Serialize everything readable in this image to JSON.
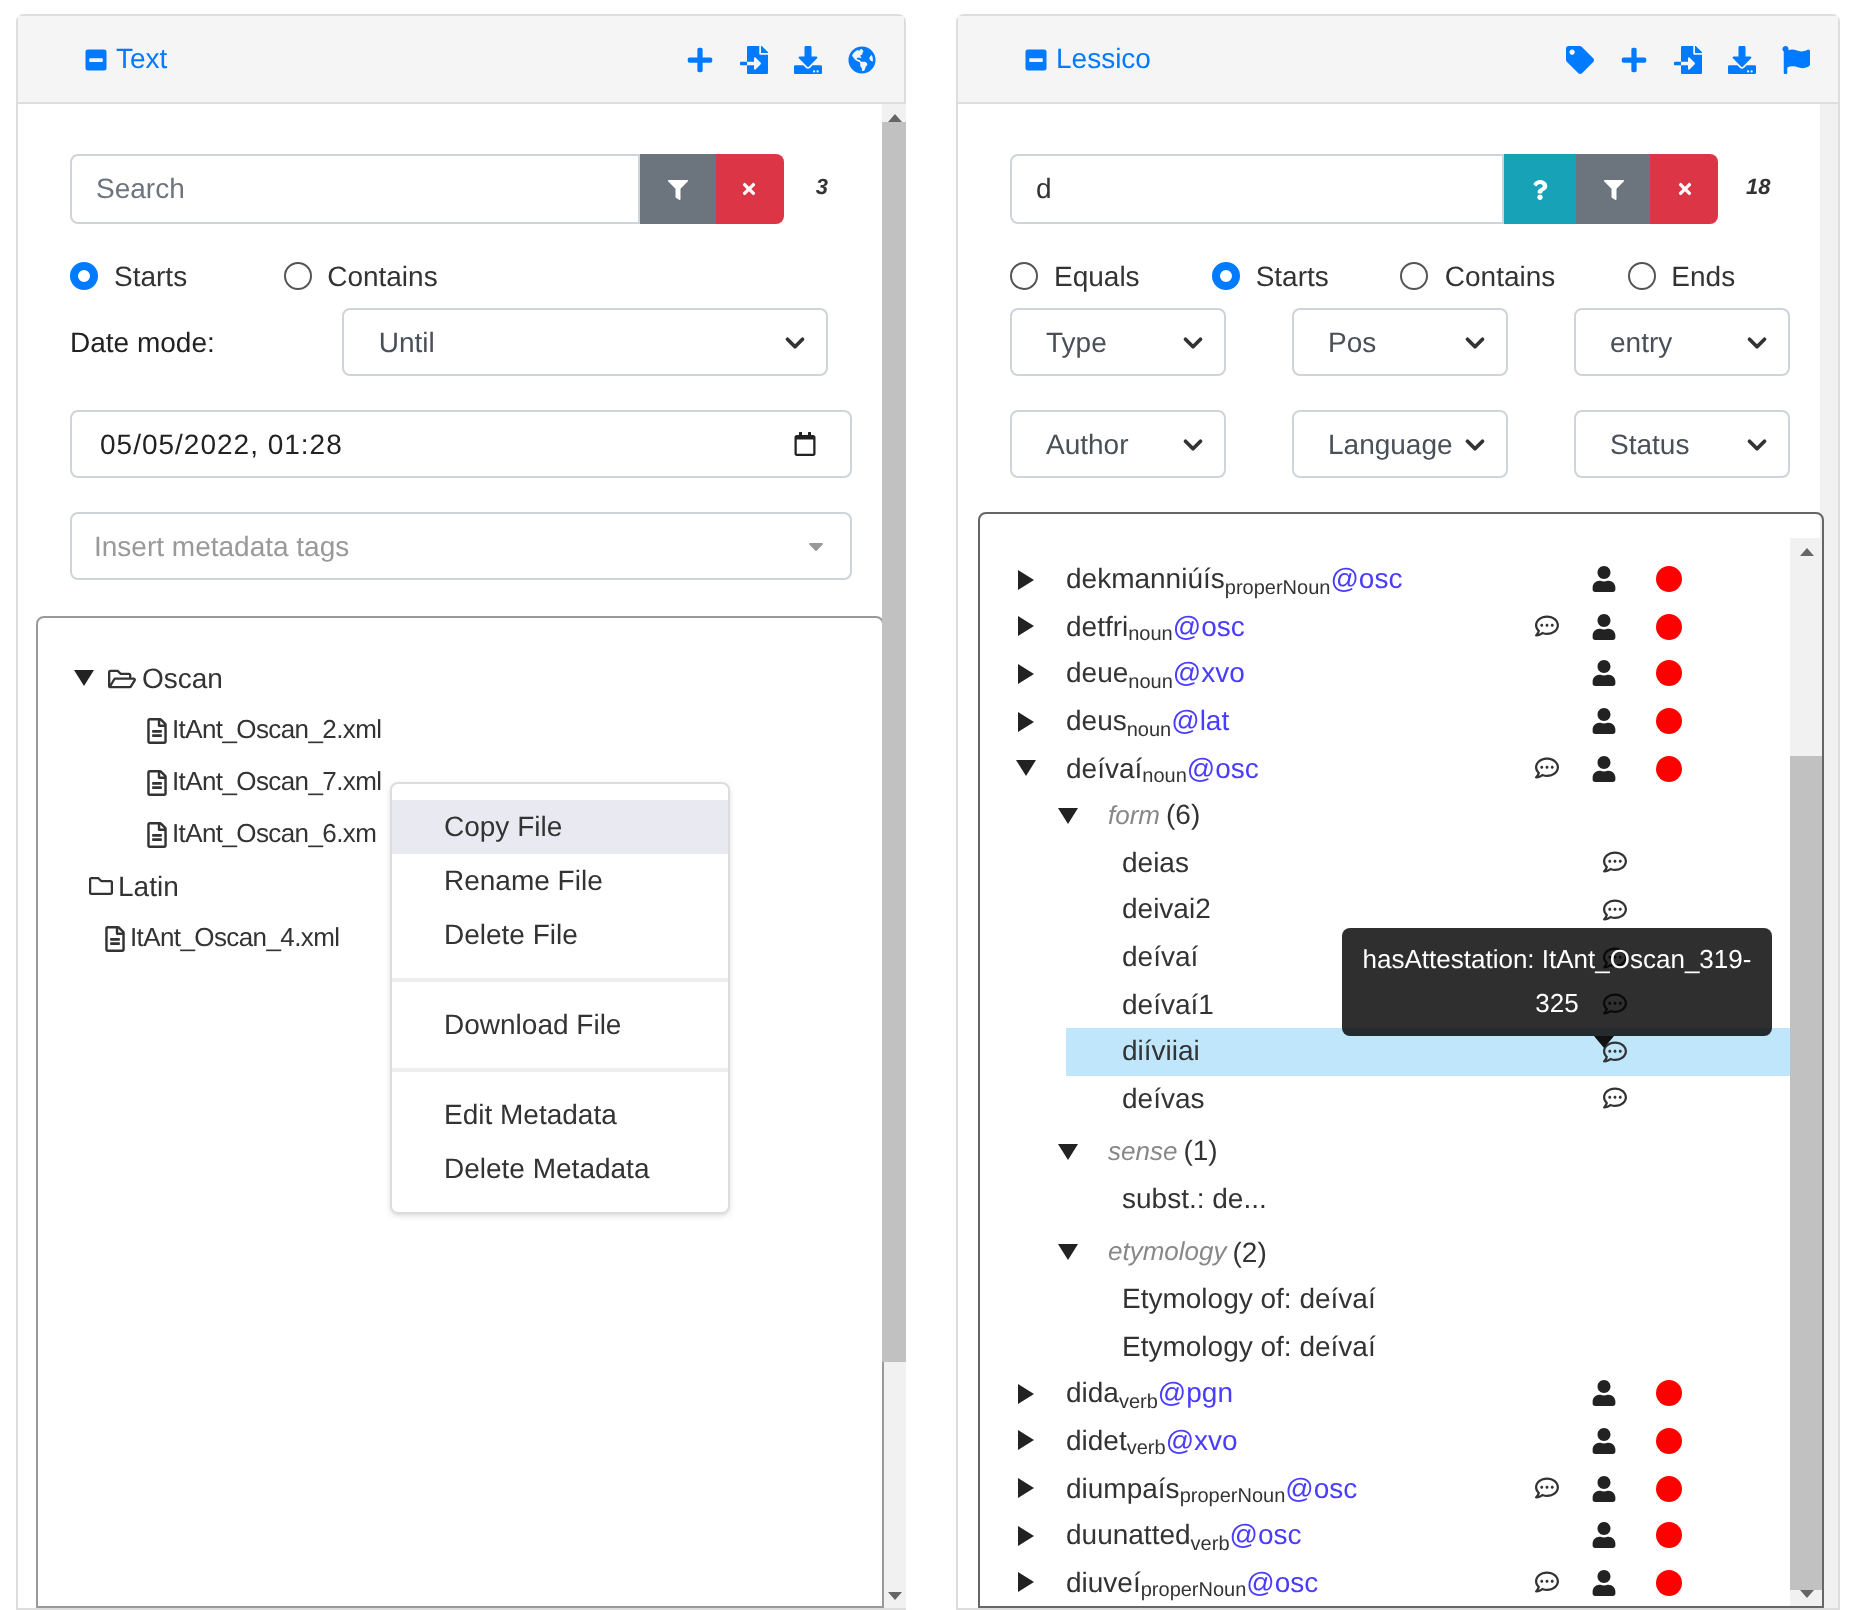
{
  "text_panel": {
    "title": "Text",
    "search": {
      "placeholder": "Search"
    },
    "count": "3",
    "match_modes": [
      {
        "label": "Starts",
        "selected": true
      },
      {
        "label": "Contains",
        "selected": false
      }
    ],
    "date_mode": {
      "label": "Date mode:",
      "value": "Until"
    },
    "date": {
      "value": "05/05/2022, 01:28"
    },
    "tags": {
      "placeholder": "Insert metadata tags"
    },
    "tree": [
      {
        "kind": "folder",
        "label": "Oscan",
        "expanded": true,
        "children": [
          {
            "kind": "file",
            "label": "ItAnt_Oscan_2.xml"
          },
          {
            "kind": "file",
            "label": "ItAnt_Oscan_7.xml"
          },
          {
            "kind": "file",
            "label": "ItAnt_Oscan_6.xm"
          }
        ]
      },
      {
        "kind": "folder",
        "label": "Latin",
        "expanded": false
      },
      {
        "kind": "file",
        "label": "ItAnt_Oscan_4.xml"
      }
    ],
    "context_menu": {
      "groups": [
        [
          {
            "label": "Copy File",
            "selected": true
          },
          {
            "label": "Rename File",
            "selected": false
          },
          {
            "label": "Delete File",
            "selected": false
          }
        ],
        [
          {
            "label": "Download File",
            "selected": false
          }
        ],
        [
          {
            "label": "Edit Metadata",
            "selected": false
          },
          {
            "label": "Delete Metadata",
            "selected": false
          }
        ]
      ]
    }
  },
  "lexicon_panel": {
    "title": "Lessico",
    "search": {
      "value": "d"
    },
    "count": "18",
    "match_modes": [
      {
        "label": "Equals",
        "selected": false
      },
      {
        "label": "Starts",
        "selected": true
      },
      {
        "label": "Contains",
        "selected": false
      },
      {
        "label": "Ends",
        "selected": false
      }
    ],
    "filters": [
      {
        "label": "Type"
      },
      {
        "label": "Pos"
      },
      {
        "label": "entry"
      },
      {
        "label": "Author"
      },
      {
        "label": "Language"
      },
      {
        "label": "Status"
      }
    ],
    "entries": [
      {
        "word": "dekmanniúís",
        "pos": "properNoun",
        "lang": "@osc",
        "comment": false,
        "expanded": false,
        "color": "#ff0000"
      },
      {
        "word": "detfri",
        "pos": "noun",
        "lang": "@osc",
        "comment": true,
        "expanded": false,
        "color": "#ff0000"
      },
      {
        "word": "deue",
        "pos": "noun",
        "lang": "@xvo",
        "comment": false,
        "expanded": false,
        "color": "#ff0000"
      },
      {
        "word": "deus",
        "pos": "noun",
        "lang": "@lat",
        "comment": false,
        "expanded": false,
        "color": "#ff0000"
      },
      {
        "word": "deívaí",
        "pos": "noun",
        "lang": "@osc",
        "comment": true,
        "expanded": true,
        "color": "#ff0000",
        "sections": [
          {
            "label": "form",
            "count": "(6)",
            "expanded": true,
            "children": [
              {
                "label": "deias",
                "comment": true,
                "selected": false
              },
              {
                "label": "deivai2",
                "comment": true,
                "selected": false
              },
              {
                "label": "deívaí",
                "comment": true,
                "selected": false
              },
              {
                "label": "deívaí1",
                "comment": true,
                "selected": false
              },
              {
                "label": "diíviiai",
                "comment": true,
                "selected": true,
                "tooltip": "hasAttestation: ItAnt_Oscan_319-325"
              },
              {
                "label": "deívas",
                "comment": true,
                "selected": false
              }
            ]
          },
          {
            "label": "sense",
            "count": "(1)",
            "expanded": true,
            "children": [
              {
                "label": "subst.: de...",
                "comment": false,
                "selected": false
              }
            ]
          },
          {
            "label": "etymology",
            "count": "(2)",
            "expanded": true,
            "children": [
              {
                "label": "Etymology of: deívaí",
                "comment": false,
                "selected": false
              },
              {
                "label": "Etymology of: deívaí",
                "comment": false,
                "selected": false
              }
            ]
          }
        ]
      },
      {
        "word": "dida",
        "pos": "verb",
        "lang": "@pgn",
        "comment": false,
        "expanded": false,
        "color": "#ff0000"
      },
      {
        "word": "didet",
        "pos": "verb",
        "lang": "@xvo",
        "comment": false,
        "expanded": false,
        "color": "#ff0000"
      },
      {
        "word": "diumpaís",
        "pos": "properNoun",
        "lang": "@osc",
        "comment": true,
        "expanded": false,
        "color": "#ff0000"
      },
      {
        "word": "duunatted",
        "pos": "verb",
        "lang": "@osc",
        "comment": false,
        "expanded": false,
        "color": "#ff0000"
      },
      {
        "word": "diuveí",
        "pos": "properNoun",
        "lang": "@osc",
        "comment": true,
        "expanded": false,
        "color": "#ff0000"
      }
    ]
  }
}
